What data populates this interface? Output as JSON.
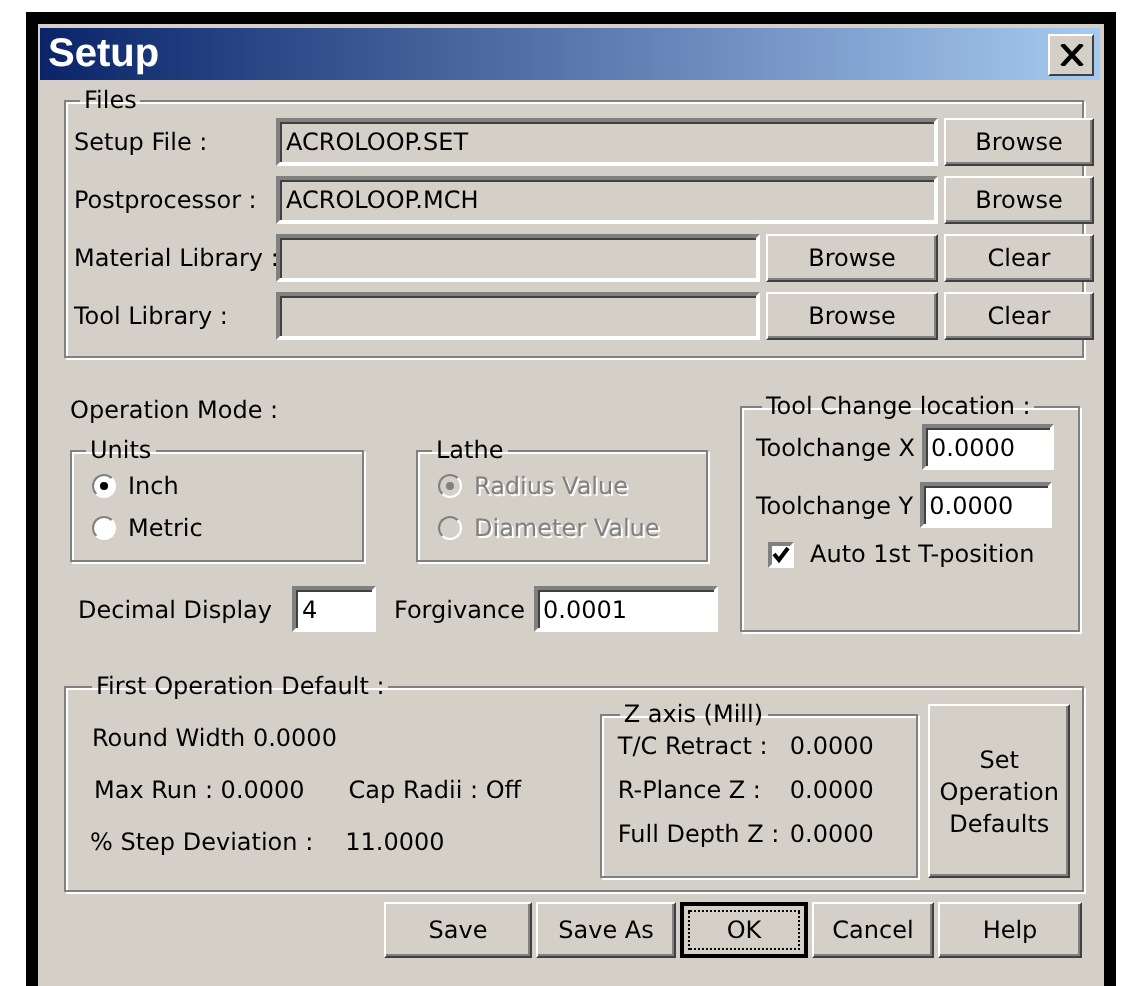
{
  "window": {
    "title": "Setup"
  },
  "files": {
    "title": "Files",
    "rows": [
      {
        "label": "Setup File  :",
        "value": "ACROLOOP.SET",
        "buttons": [
          "Browse"
        ]
      },
      {
        "label": "Postprocessor :",
        "value": "ACROLOOP.MCH",
        "buttons": [
          "Browse"
        ]
      },
      {
        "label": "Material Library :",
        "buttons": [
          "Browse",
          "Clear"
        ]
      },
      {
        "label": "Tool Library :",
        "buttons": [
          "Browse",
          "Clear"
        ]
      }
    ]
  },
  "operation_mode": {
    "label": "Operation Mode :",
    "units": {
      "title": "Units",
      "disabled": false,
      "options": [
        {
          "label": "Inch",
          "selected": true
        },
        {
          "label": "Metric",
          "selected": false
        }
      ]
    },
    "lathe": {
      "title": "Lathe",
      "disabled": true,
      "options": [
        {
          "label": "Radius Value",
          "selected": true
        },
        {
          "label": "Diameter Value",
          "selected": false
        }
      ]
    },
    "decimal_display": {
      "label": "Decimal Display",
      "value": "4"
    },
    "forgivance": {
      "label": "Forgivance",
      "value": "0.0001"
    }
  },
  "tool_change": {
    "title": "Tool Change location :",
    "fields": [
      {
        "label": "Toolchange X",
        "value": "0.0000"
      },
      {
        "label": "Toolchange Y",
        "value": "0.0000"
      }
    ],
    "auto_position": {
      "label": "Auto 1st T-position",
      "checked": true
    }
  },
  "first_operation": {
    "title": "First Operation Default :",
    "round_width": "Round  Width 0.0000",
    "max_run": "Max Run : 0.0000",
    "cap_radii": "Cap Radii : Off",
    "step_deviation": {
      "label": "% Step Deviation :",
      "value": "11.0000"
    },
    "z_axis": {
      "title": "Z axis (Mill)",
      "rows": [
        {
          "label": "T/C Retract :",
          "value": "0.0000"
        },
        {
          "label": "R-Plance Z :",
          "value": "0.0000"
        },
        {
          "label": "Full Depth Z :",
          "value": "0.0000"
        }
      ]
    },
    "set_defaults_button": "Set Operation Defaults"
  },
  "buttons": [
    {
      "label": "Save",
      "default": false
    },
    {
      "label": "Save As",
      "default": false
    },
    {
      "label": "OK",
      "default": true
    },
    {
      "label": "Cancel",
      "default": false
    },
    {
      "label": "Help",
      "default": false
    }
  ]
}
